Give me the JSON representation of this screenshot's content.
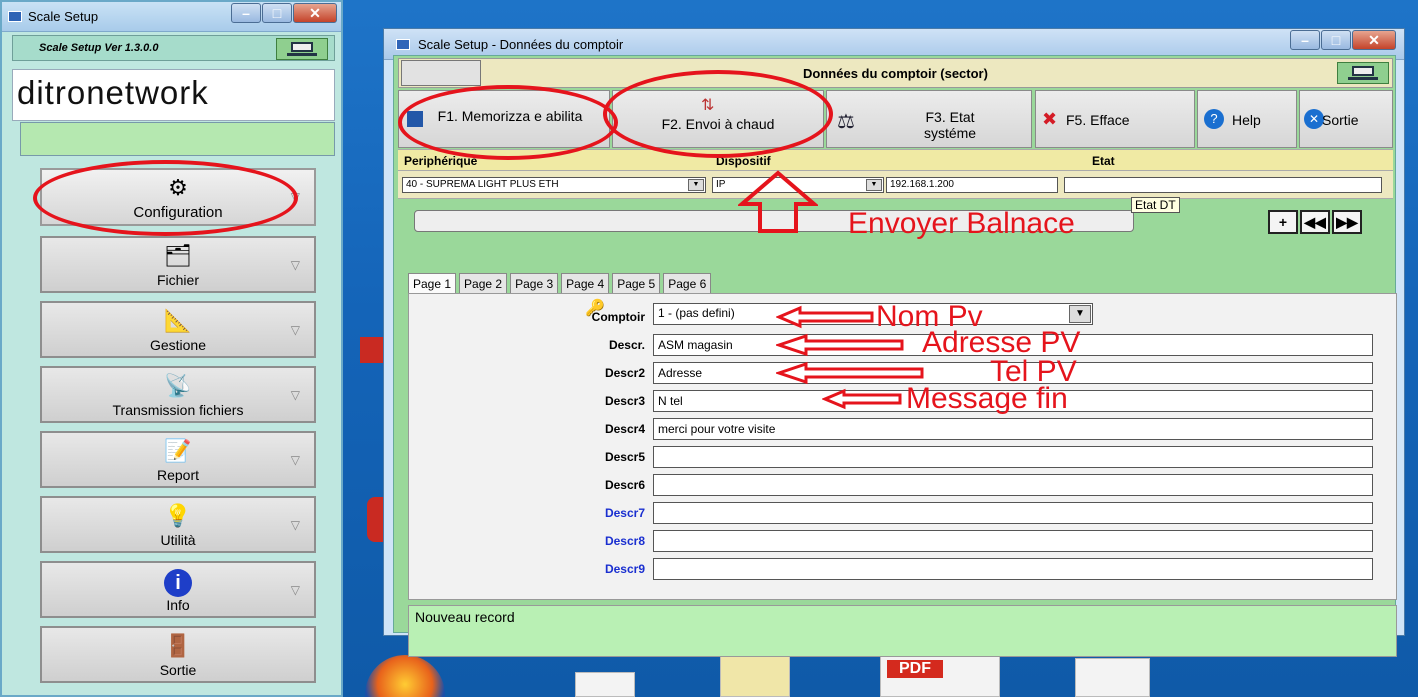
{
  "left_window": {
    "title": "Scale Setup",
    "version": "Scale Setup Ver 1.3.0.0",
    "logo": "ditronetwork",
    "nav": [
      {
        "label": "Configuration",
        "icon": "gears-icon"
      },
      {
        "label": "Fichier",
        "icon": "card-file-icon"
      },
      {
        "label": "Gestione",
        "icon": "drafting-icon"
      },
      {
        "label": "Transmission fichiers",
        "icon": "satellite-dish-icon"
      },
      {
        "label": "Report",
        "icon": "document-pen-icon"
      },
      {
        "label": "Utilità",
        "icon": "lightbulb-icon"
      },
      {
        "label": "Info",
        "icon": "info-icon"
      },
      {
        "label": "Sortie",
        "icon": "exit-door-icon"
      }
    ]
  },
  "main_window": {
    "title": "Scale Setup - Données du comptoir",
    "header_title": "Données du comptoir  (sector)",
    "toolbar": {
      "memorize_label": "F1. Memorizza e abilita",
      "send_label": "F2. Envoi à chaud",
      "state_label": "F3. Etat systéme",
      "erase_label": "F5. Efface",
      "help_label": "Help",
      "exit_label": "Sortie"
    },
    "columns": {
      "peripheral": "Periphérique",
      "device": "Dispositif",
      "state": "Etat"
    },
    "device_row": {
      "peripheral_value": "40 - SUPREMA LIGHT PLUS ETH",
      "device_value": "IP",
      "ip_value": "192.168.1.200",
      "state_value": ""
    },
    "tooltip": "Etat DT",
    "tabs": [
      "Page 1",
      "Page 2",
      "Page 3",
      "Page 4",
      "Page 5",
      "Page 6"
    ],
    "form": {
      "comptoir_label": "Comptoir",
      "comptoir_value": "1 - (pas defini)",
      "fields": [
        {
          "label": "Descr.",
          "value": "ASM magasin"
        },
        {
          "label": "Descr2",
          "value": "Adresse"
        },
        {
          "label": "Descr3",
          "value": "N tel"
        },
        {
          "label": "Descr4",
          "value": "merci pour votre visite"
        },
        {
          "label": "Descr5",
          "value": ""
        },
        {
          "label": "Descr6",
          "value": ""
        },
        {
          "label": "Descr7",
          "value": ""
        },
        {
          "label": "Descr8",
          "value": ""
        },
        {
          "label": "Descr9",
          "value": ""
        }
      ]
    },
    "status": "Nouveau record"
  },
  "annotations": {
    "send_balance": "Envoyer Balnace",
    "name_pv": "Nom Pv",
    "address_pv": "Adresse PV",
    "tel_pv": "Tel PV",
    "message_end": "Message fin"
  },
  "desktop": {
    "pdf_label": "PDF"
  },
  "colors": {
    "annotation": "#e5141c",
    "panel_green": "#9ad89a",
    "header_yellow": "#ede8c0"
  }
}
